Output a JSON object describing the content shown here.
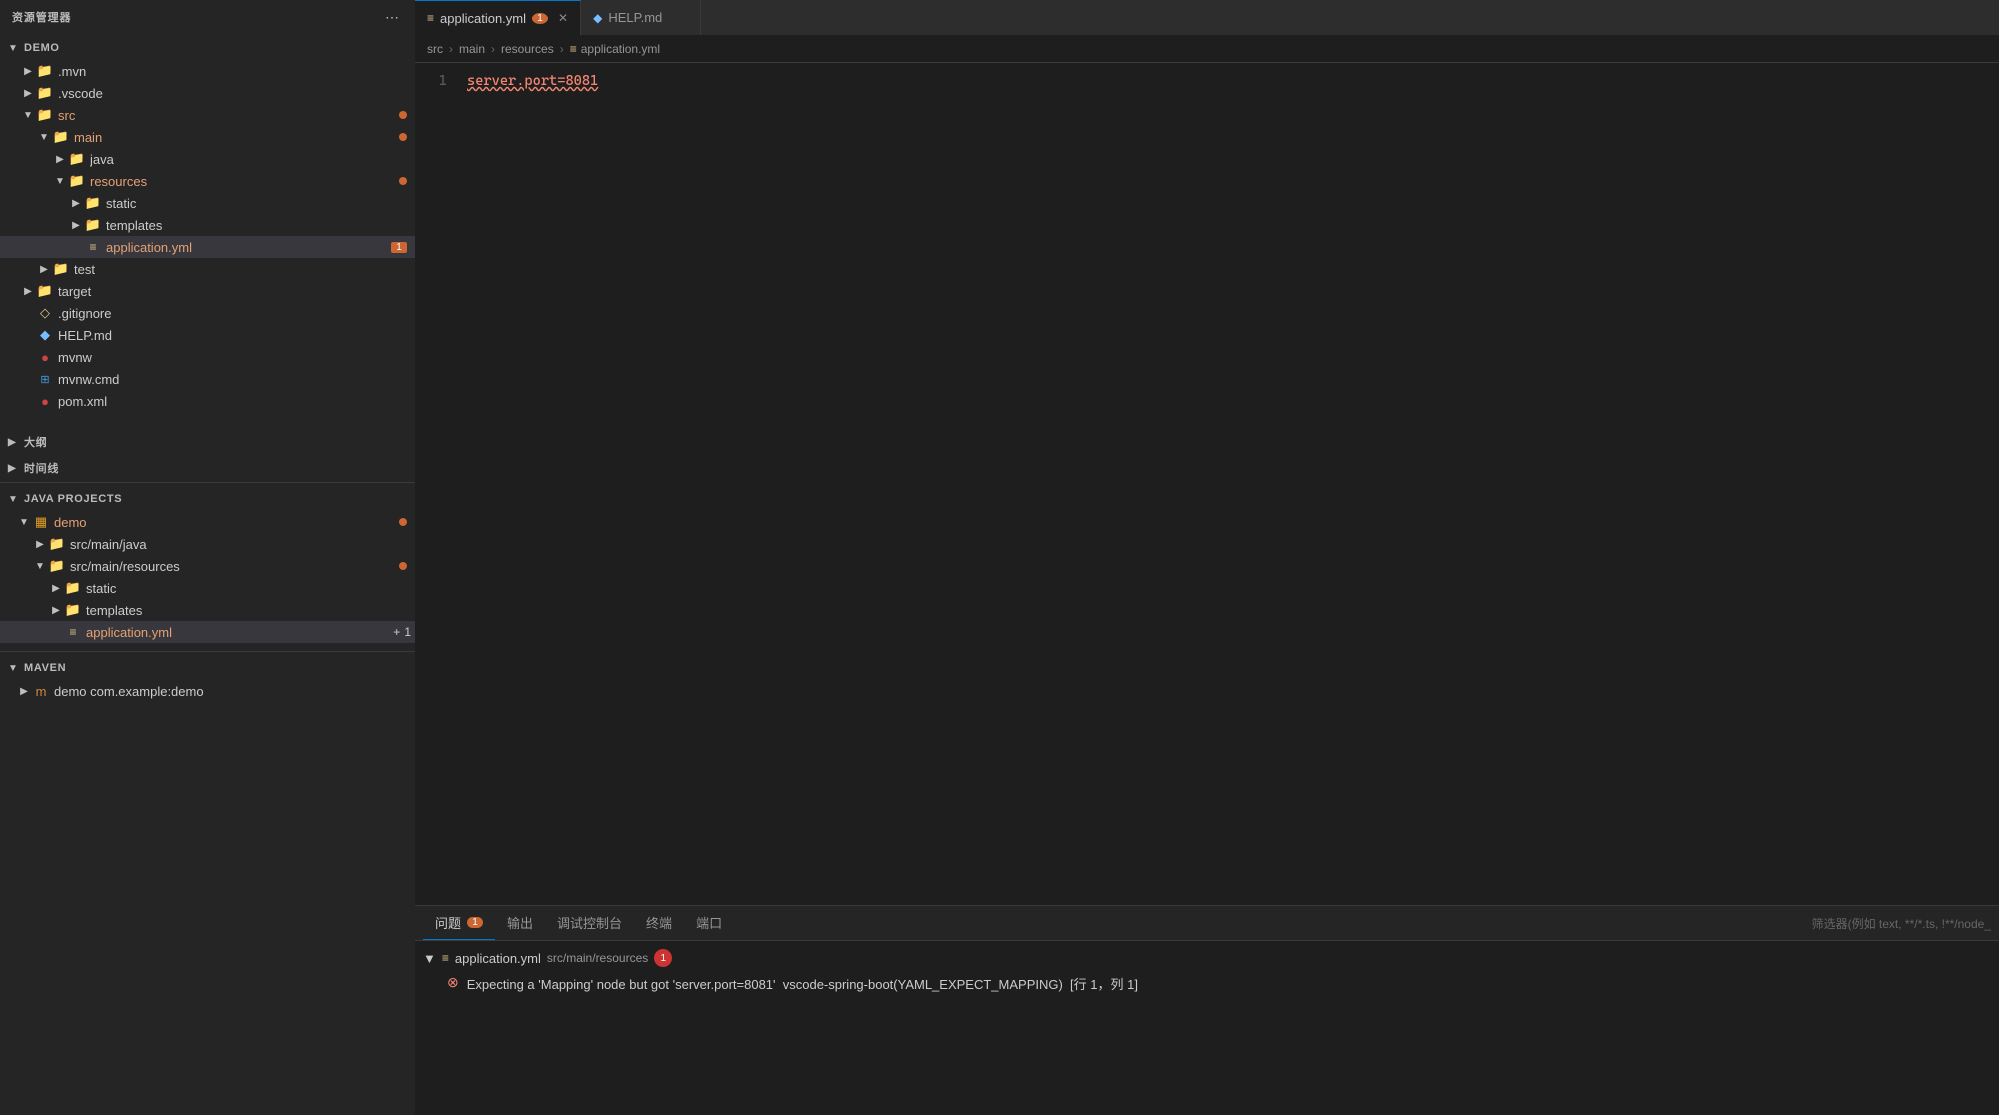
{
  "sidebar": {
    "title": "资源管理器",
    "more_icon": "⋯",
    "sections": {
      "demo": {
        "label": "DEMO",
        "expanded": true,
        "items": [
          {
            "id": "mvn",
            "label": ".mvn",
            "indent": 20,
            "icon": "▶",
            "type": "folder"
          },
          {
            "id": "vscode",
            "label": ".vscode",
            "indent": 20,
            "icon": "▶",
            "type": "folder"
          },
          {
            "id": "src",
            "label": "src",
            "indent": 20,
            "icon": "▼",
            "type": "folder",
            "dot": true
          },
          {
            "id": "main",
            "label": "main",
            "indent": 36,
            "icon": "▼",
            "type": "folder",
            "dot": true
          },
          {
            "id": "java",
            "label": "java",
            "indent": 52,
            "icon": "▶",
            "type": "folder"
          },
          {
            "id": "resources",
            "label": "resources",
            "indent": 52,
            "icon": "▼",
            "type": "folder",
            "dot": true,
            "color": "orange"
          },
          {
            "id": "static",
            "label": "static",
            "indent": 68,
            "icon": "▶",
            "type": "folder"
          },
          {
            "id": "templates",
            "label": "templates",
            "indent": 68,
            "icon": "▶",
            "type": "folder"
          },
          {
            "id": "application.yml",
            "label": "application.yml",
            "indent": 68,
            "icon": "",
            "type": "file",
            "badge": "1",
            "color": "orange",
            "selected": true
          },
          {
            "id": "test",
            "label": "test",
            "indent": 36,
            "icon": "▶",
            "type": "folder"
          },
          {
            "id": "target",
            "label": "target",
            "indent": 20,
            "icon": "▶",
            "type": "folder"
          },
          {
            "id": "gitignore",
            "label": ".gitignore",
            "indent": 20,
            "icon": "",
            "type": "file"
          },
          {
            "id": "HELP.md",
            "label": "HELP.md",
            "indent": 20,
            "icon": "",
            "type": "file",
            "iconColor": "blue"
          },
          {
            "id": "mvnw",
            "label": "mvnw",
            "indent": 20,
            "icon": "",
            "type": "file",
            "iconColor": "orange"
          },
          {
            "id": "mvnw.cmd",
            "label": "mvnw.cmd",
            "indent": 20,
            "icon": "",
            "type": "file",
            "iconColor": "windows"
          },
          {
            "id": "pom.xml",
            "label": "pom.xml",
            "indent": 20,
            "icon": "",
            "type": "file",
            "iconColor": "orange"
          }
        ]
      },
      "outline": {
        "label": "大纲",
        "expanded": false
      },
      "timeline": {
        "label": "时间线",
        "expanded": false
      },
      "java_projects": {
        "label": "JAVA PROJECTS",
        "expanded": true,
        "items": [
          {
            "id": "jp_demo",
            "label": "demo",
            "indent": 16,
            "icon": "▼",
            "dot": true,
            "iconType": "java"
          },
          {
            "id": "jp_src_main_java",
            "label": "src/main/java",
            "indent": 32,
            "icon": "▶",
            "iconType": "folder"
          },
          {
            "id": "jp_src_main_resources",
            "label": "src/main/resources",
            "indent": 32,
            "icon": "▼",
            "dot": true,
            "iconType": "folder"
          },
          {
            "id": "jp_static",
            "label": "static",
            "indent": 48,
            "icon": "▶",
            "iconType": "folder"
          },
          {
            "id": "jp_templates",
            "label": "templates",
            "indent": 48,
            "icon": "▶",
            "iconType": "folder"
          },
          {
            "id": "jp_application_yml",
            "label": "application.yml",
            "indent": 48,
            "icon": "",
            "type": "file",
            "color": "orange",
            "addBadge": "+1",
            "selected": true
          }
        ]
      },
      "maven": {
        "label": "MAVEN",
        "expanded": true,
        "items": [
          {
            "id": "maven_demo",
            "label": "demo",
            "indent": 16,
            "sublabel": "com.example:demo"
          }
        ]
      }
    }
  },
  "editor": {
    "tabs": [
      {
        "id": "application.yml",
        "label": "application.yml",
        "icon": "≡",
        "iconColor": "#e2c08d",
        "active": true,
        "modified": true,
        "count": "1"
      },
      {
        "id": "HELP.md",
        "label": "HELP.md",
        "icon": "◆",
        "iconColor": "#75beff",
        "active": false
      }
    ],
    "breadcrumb": {
      "parts": [
        "src",
        "main",
        "resources"
      ],
      "current_icon": "≡",
      "current": "application.yml"
    },
    "lines": [
      {
        "number": 1,
        "content": "server.port=8081",
        "hasError": true
      }
    ]
  },
  "panel": {
    "tabs": [
      {
        "id": "problems",
        "label": "问题",
        "count": "1",
        "active": true
      },
      {
        "id": "output",
        "label": "输出",
        "active": false
      },
      {
        "id": "debug_console",
        "label": "调试控制台",
        "active": false
      },
      {
        "id": "terminal",
        "label": "终端",
        "active": false
      },
      {
        "id": "port",
        "label": "端口",
        "active": false
      }
    ],
    "filter_placeholder": "筛选器(例如 text, **/*.ts, !**/node_",
    "problems": {
      "groups": [
        {
          "file": "application.yml",
          "path": "src/main/resources",
          "count": "1",
          "expanded": true,
          "items": [
            {
              "type": "error",
              "message": "Expecting a 'Mapping' node but got 'server.port=8081'  vscode-spring-boot(YAML_EXPECT_MAPPING)  [行 1，列 1]"
            }
          ]
        }
      ]
    }
  }
}
